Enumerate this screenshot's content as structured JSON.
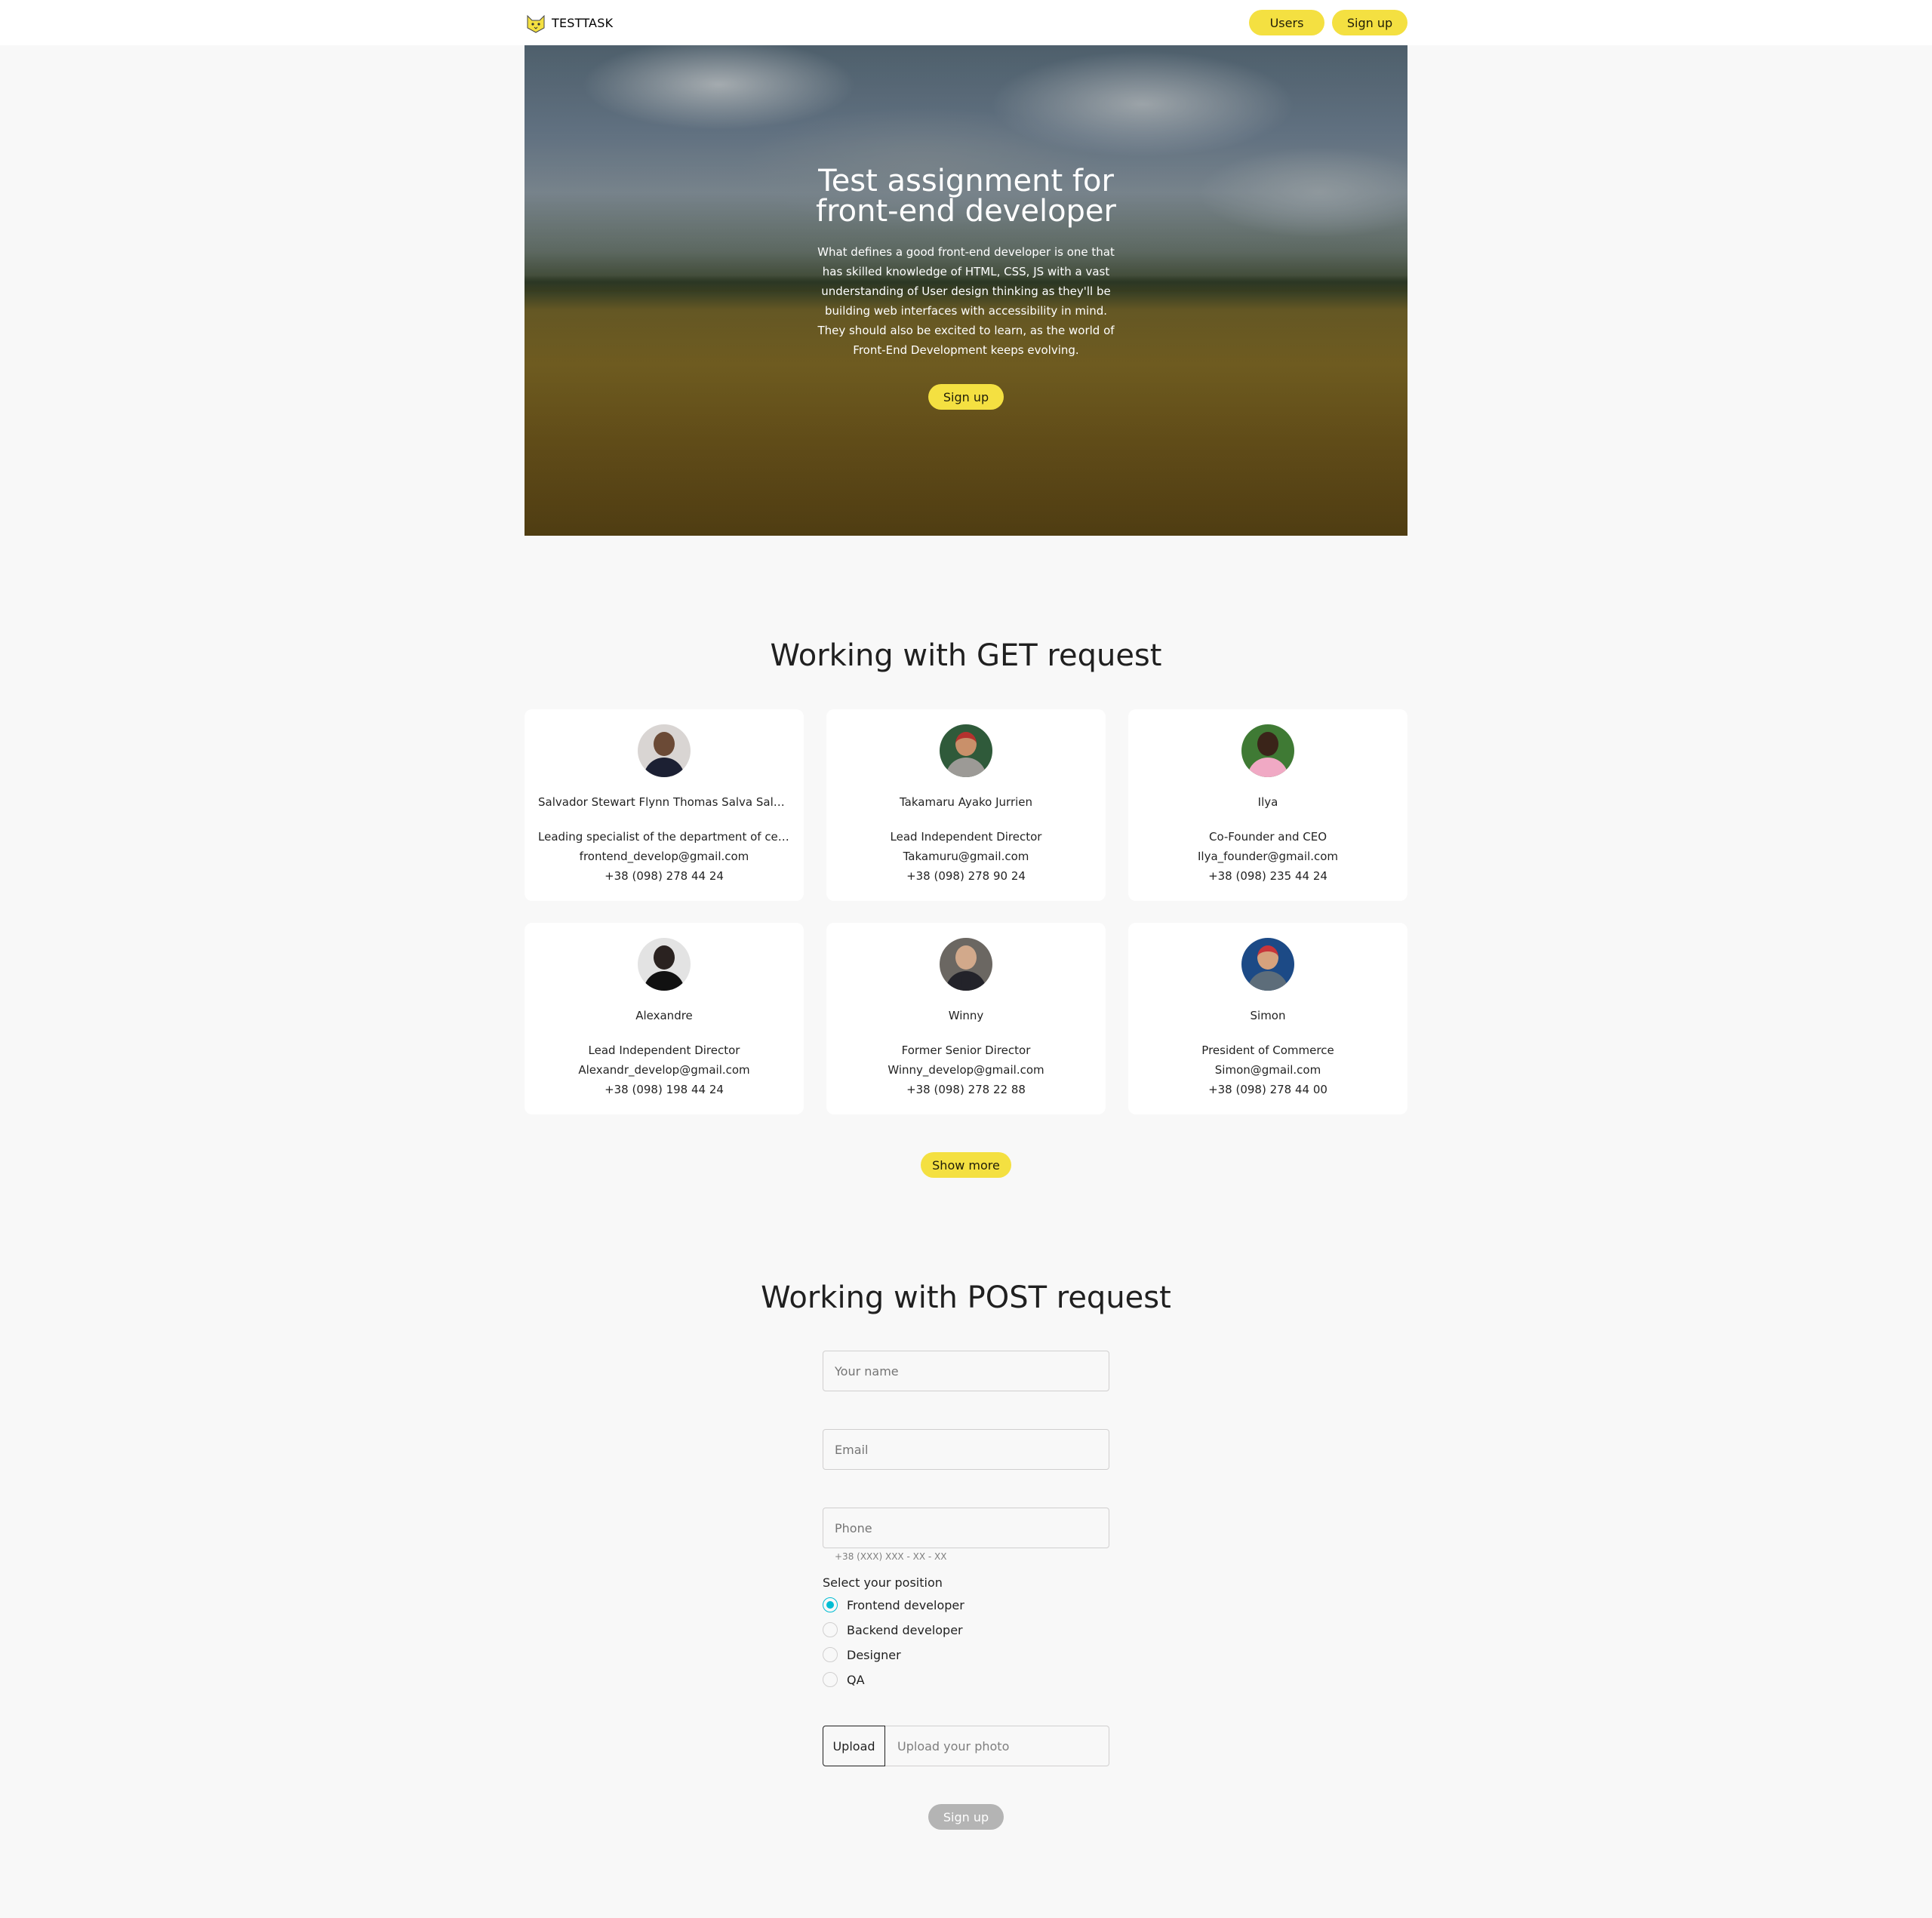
{
  "header": {
    "logo_text": "TESTTASK",
    "nav": {
      "users_label": "Users",
      "signup_label": "Sign up"
    }
  },
  "hero": {
    "title_line1": "Test assignment for",
    "title_line2": "front-end developer",
    "text": "What defines a good front-end developer is one that has skilled knowledge of HTML, CSS, JS with a vast understanding of User design thinking as they'll be building web interfaces with accessibility in mind. They should also be excited to learn, as the world of Front-End Development keeps evolving.",
    "button_label": "Sign up"
  },
  "get_section": {
    "title": "Working with GET request",
    "users": [
      {
        "name": "Salvador Stewart Flynn Thomas Salva Salvemini",
        "position": "Leading specialist of the department of centralized",
        "email": "frontend_develop@gmail.com",
        "phone": "+38 (098) 278 44 24"
      },
      {
        "name": "Takamaru Ayako Jurrien",
        "position": "Lead Independent Director",
        "email": "Takamuru@gmail.com",
        "phone": "+38 (098) 278 90 24"
      },
      {
        "name": "Ilya",
        "position": "Co-Founder and CEO",
        "email": "Ilya_founder@gmail.com",
        "phone": "+38 (098) 235 44 24"
      },
      {
        "name": "Alexandre",
        "position": "Lead Independent Director",
        "email": "Alexandr_develop@gmail.com",
        "phone": "+38 (098) 198 44 24"
      },
      {
        "name": "Winny",
        "position": "Former Senior Director",
        "email": "Winny_develop@gmail.com",
        "phone": "+38 (098) 278 22 88"
      },
      {
        "name": "Simon",
        "position": "President of Commerce",
        "email": "Simon@gmail.com",
        "phone": "+38 (098) 278 44 00"
      }
    ],
    "show_more_label": "Show more"
  },
  "post_section": {
    "title": "Working with POST request",
    "name_placeholder": "Your name",
    "email_placeholder": "Email",
    "phone_placeholder": "Phone",
    "phone_helper": "+38 (XXX) XXX - XX - XX",
    "position_label": "Select your position",
    "positions": [
      {
        "label": "Frontend developer",
        "checked": true
      },
      {
        "label": "Backend developer",
        "checked": false
      },
      {
        "label": "Designer",
        "checked": false
      },
      {
        "label": "QA",
        "checked": false
      }
    ],
    "upload_button_label": "Upload",
    "upload_placeholder": "Upload your photo",
    "submit_label": "Sign up"
  },
  "colors": {
    "primary": "#f4e041",
    "secondary": "#00bdd3",
    "background": "#f8f8f8",
    "disabled": "#b4b4b4"
  }
}
